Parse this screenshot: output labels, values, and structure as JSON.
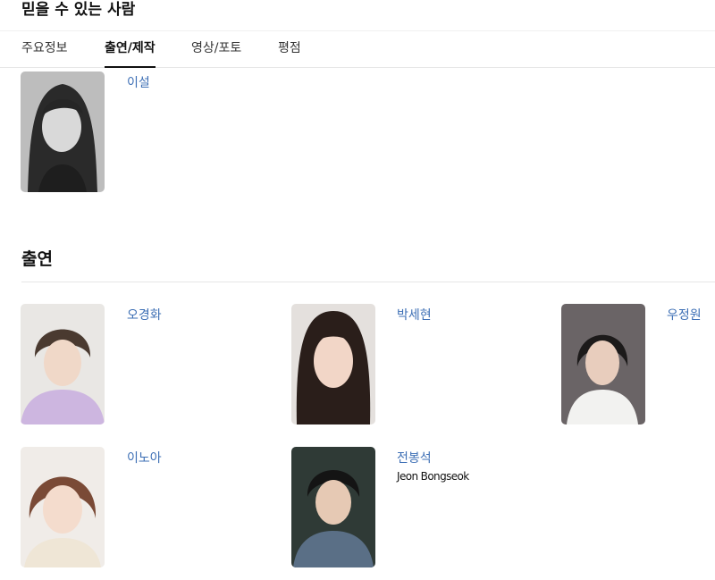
{
  "page": {
    "title": "믿을 수 있는 사람"
  },
  "tabs": [
    {
      "label": "주요정보"
    },
    {
      "label": "출연/제작"
    },
    {
      "label": "영상/포토"
    },
    {
      "label": "평점"
    }
  ],
  "director": {
    "name": "이설"
  },
  "cast_section": {
    "title": "출연",
    "people": [
      {
        "name": "오경화",
        "name_en": ""
      },
      {
        "name": "박세현",
        "name_en": ""
      },
      {
        "name": "우정원",
        "name_en": ""
      },
      {
        "name": "이노아",
        "name_en": ""
      },
      {
        "name": "전봉석",
        "name_en": "Jeon Bongseok"
      }
    ]
  }
}
